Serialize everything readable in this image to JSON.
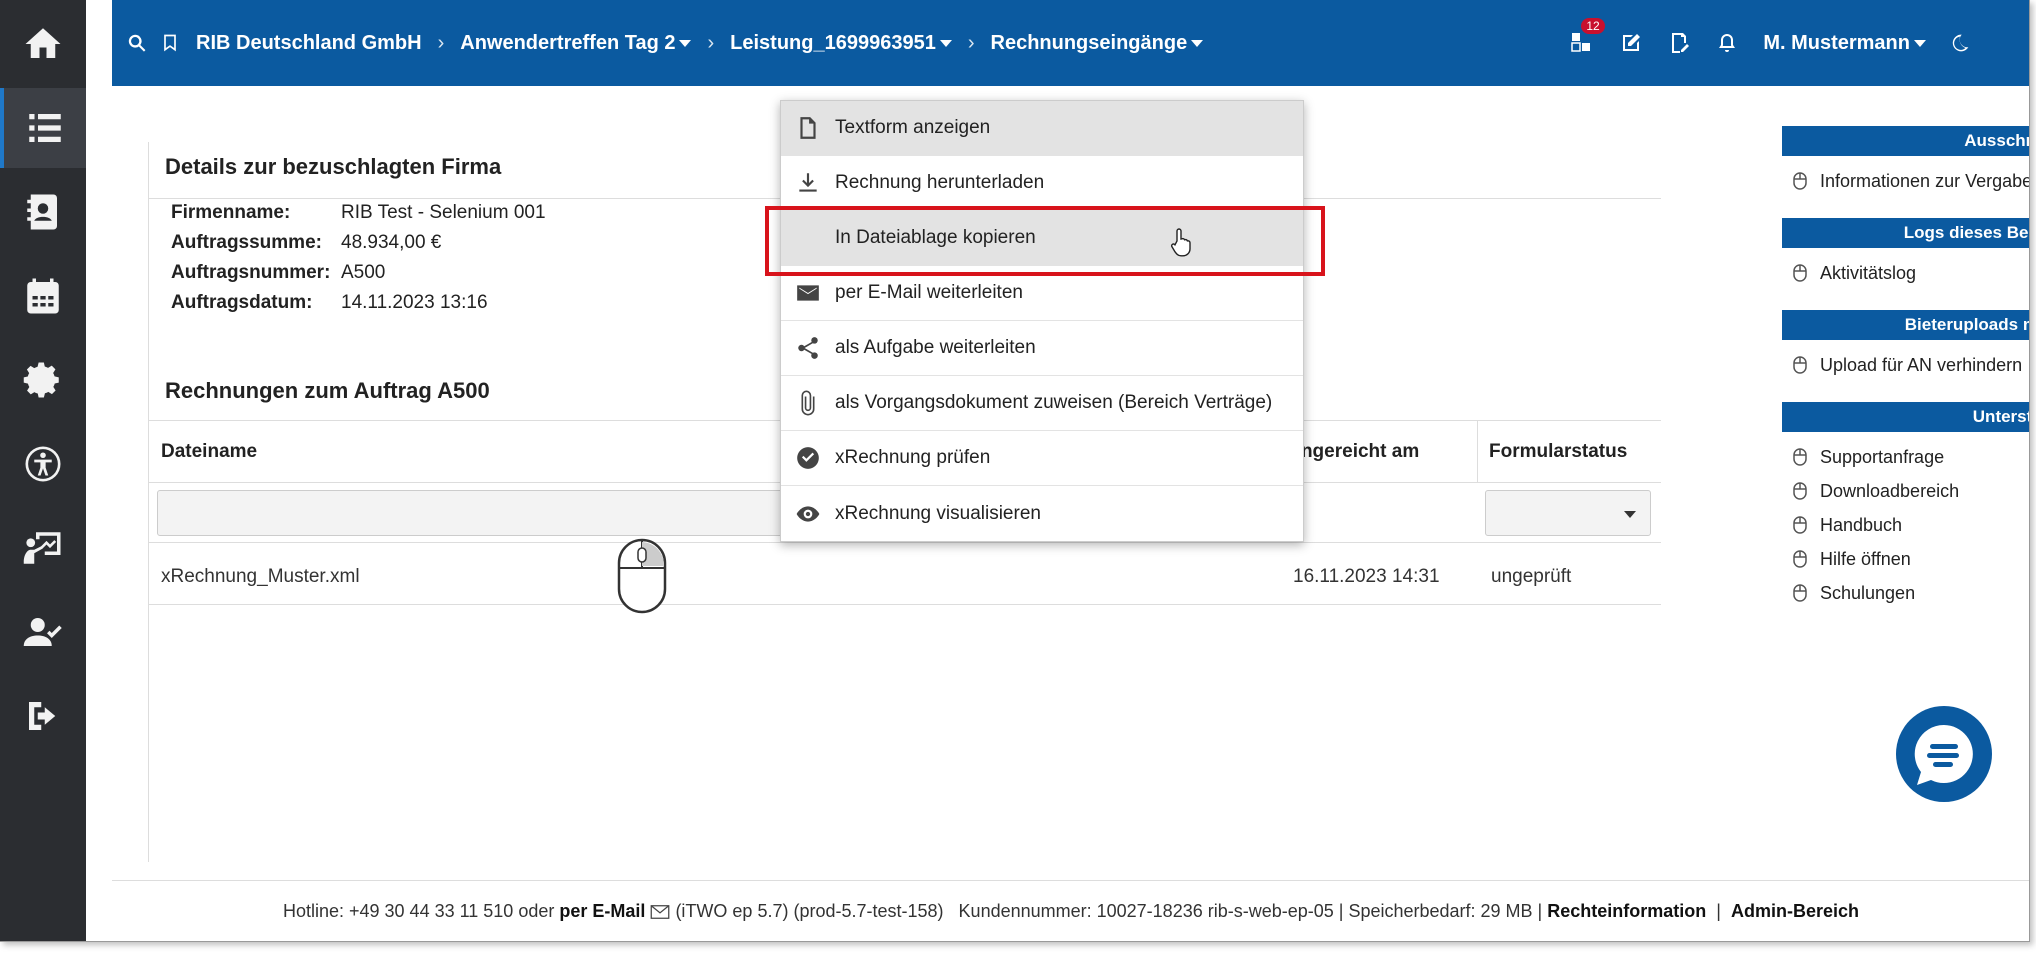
{
  "topbar": {
    "crumbs": [
      "RIB Deutschland GmbH",
      "Anwendertreffen Tag 2",
      "Leistung_1699963951",
      "Rechnungseingänge"
    ],
    "notification_count": "12",
    "user": "M. Mustermann"
  },
  "details": {
    "title": "Details zur bezuschlagten Firma",
    "rows": [
      {
        "label": "Firmenname:",
        "value": "RIB Test - Selenium 001"
      },
      {
        "label": "Auftragssumme:",
        "value": "48.934,00 €"
      },
      {
        "label": "Auftragsnummer:",
        "value": "A500"
      },
      {
        "label": "Auftragsdatum:",
        "value": "14.11.2023 13:16"
      }
    ]
  },
  "invoices": {
    "title": "Rechnungen zum Auftrag A500",
    "columns": {
      "filename": "Dateiname",
      "submitted": "Eingereicht am",
      "status": "Formularstatus"
    },
    "rows": [
      {
        "filename": "xRechnung_Muster.xml",
        "submitted": "16.11.2023 14:31",
        "status": "ungeprüft"
      }
    ]
  },
  "context_menu": {
    "items": [
      {
        "label": "Textform anzeigen",
        "icon": "document-icon"
      },
      {
        "label": "Rechnung herunterladen",
        "icon": "download-icon"
      },
      {
        "label": "In Dateiablage kopieren",
        "icon": ""
      },
      {
        "label": "per E-Mail weiterleiten",
        "icon": "envelope-icon"
      },
      {
        "label": "als Aufgabe weiterleiten",
        "icon": "share-icon"
      },
      {
        "label": "als Vorgangsdokument zuweisen (Bereich Verträge)",
        "icon": "paperclip-icon"
      },
      {
        "label": "xRechnung prüfen",
        "icon": "check-circle-icon"
      },
      {
        "label": "xRechnung visualisieren",
        "icon": "eye-icon"
      }
    ]
  },
  "right_panel": {
    "groups": [
      {
        "title": "Ausschreibung",
        "items": [
          "Informationen zur Vergabe"
        ]
      },
      {
        "title": "Logs dieses Bereiches",
        "items": [
          "Aktivitätslog"
        ]
      },
      {
        "title": "Bieteruploads möglich",
        "items": [
          "Upload für AN verhindern"
        ]
      },
      {
        "title": "Unterstützung",
        "items": [
          "Supportanfrage",
          "Downloadbereich",
          "Handbuch",
          "Hilfe öffnen",
          "Schulungen"
        ]
      }
    ]
  },
  "footer": {
    "hotline": "Hotline: +49 30 44 33 11 510 oder",
    "email_link": "per E-Mail",
    "version": "(iTWO ep 5.7) (prod-5.7-test-158)",
    "customer": "Kundennummer: 10027-18236 rib-s-web-ep-05 | Speicherbedarf: 29 MB |",
    "legal_link": "Rechteinformation",
    "pipe": "|",
    "admin_link": "Admin-Bereich"
  }
}
